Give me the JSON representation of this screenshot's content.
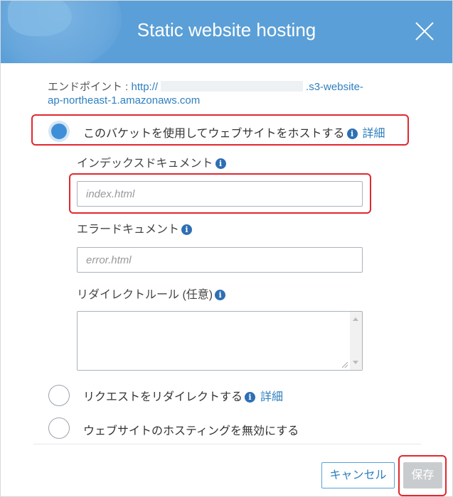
{
  "modal": {
    "title": "Static website hosting"
  },
  "endpoint": {
    "label": "エンドポイント : ",
    "url_prefix": "http://",
    "url_suffix_line1": ".s3-website-",
    "url_line2": "ap-northeast-1.amazonaws.com"
  },
  "options": {
    "host": {
      "label": "このバケットを使用してウェブサイトをホストする",
      "detail": "詳細",
      "selected": true
    },
    "redirect": {
      "label": "リクエストをリダイレクトする",
      "detail": "詳細",
      "selected": false
    },
    "disable": {
      "label": "ウェブサイトのホスティングを無効にする",
      "selected": false
    }
  },
  "fields": {
    "index_label": "インデックスドキュメント",
    "index_placeholder": "index.html",
    "error_label": "エラードキュメント",
    "error_placeholder": "error.html",
    "redirect_rules_label": "リダイレクトルール (任意)"
  },
  "buttons": {
    "cancel": "キャンセル",
    "save": "保存"
  },
  "colors": {
    "header": "#5a9fd7",
    "link": "#2e7fbf",
    "highlight": "#e0282e",
    "radio_selected": "#3f8fd8"
  }
}
